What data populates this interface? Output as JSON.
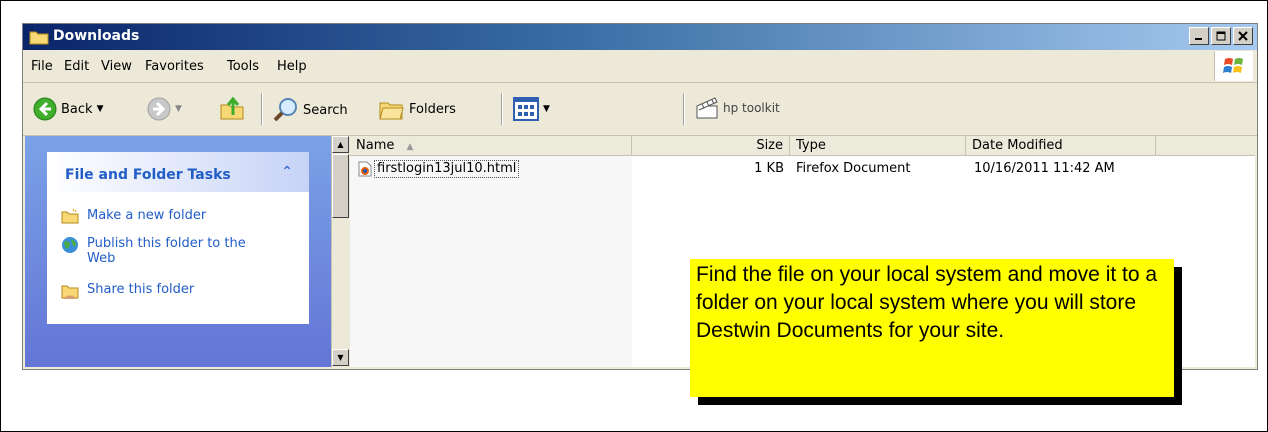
{
  "window": {
    "title": "Downloads"
  },
  "menubar": {
    "items": [
      "File",
      "Edit",
      "View",
      "Favorites",
      "Tools",
      "Help"
    ]
  },
  "toolbar": {
    "back_label": "Back",
    "search_label": "Search",
    "folders_label": "Folders",
    "hp_label": "hp toolkit"
  },
  "taskpane": {
    "title": "File and Folder Tasks",
    "tasks": [
      "Make a new folder",
      "Publish this folder to the Web",
      "Share this folder"
    ]
  },
  "filelist": {
    "columns": [
      "Name",
      "Size",
      "Type",
      "Date Modified"
    ],
    "rows": [
      {
        "name": "firstlogin13jul10.html",
        "size": "1 KB",
        "type": "Firefox Document",
        "date": "10/16/2011 11:42 AM"
      }
    ]
  },
  "callout": {
    "text": "Find the file on your local system and move it to a folder on your local system where you will store Destwin Documents for your site."
  },
  "colors": {
    "titlebar": "#0a246a",
    "task_link": "#215dc6",
    "callout_bg": "#ffff00"
  }
}
